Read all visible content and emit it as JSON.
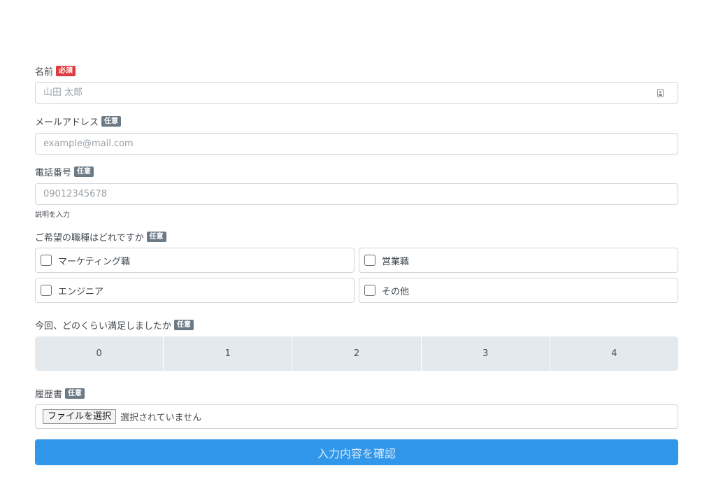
{
  "name": {
    "label": "名前",
    "badge": "必須",
    "placeholder": "山田 太郎"
  },
  "email": {
    "label": "メールアドレス",
    "badge": "任意",
    "placeholder": "example@mail.com"
  },
  "phone": {
    "label": "電話番号",
    "badge": "任意",
    "placeholder": "09012345678",
    "help": "説明を入力"
  },
  "jobs": {
    "label": "ご希望の職種はどれですか",
    "badge": "任意",
    "options": [
      "マーケティング職",
      "営業職",
      "エンジニア",
      "その他"
    ]
  },
  "satisfaction": {
    "label": "今回、どのくらい満足しましたか",
    "badge": "任意",
    "options": [
      "0",
      "1",
      "2",
      "3",
      "4"
    ]
  },
  "resume": {
    "label": "履歴書",
    "badge": "任意",
    "button_label": "ファイルを選択",
    "status": "選択されていません"
  },
  "submit_label": "入力内容を確認",
  "colors": {
    "required_badge": "#dc3b3f",
    "optional_badge": "#6c7a86",
    "submit": "#3197ea"
  }
}
